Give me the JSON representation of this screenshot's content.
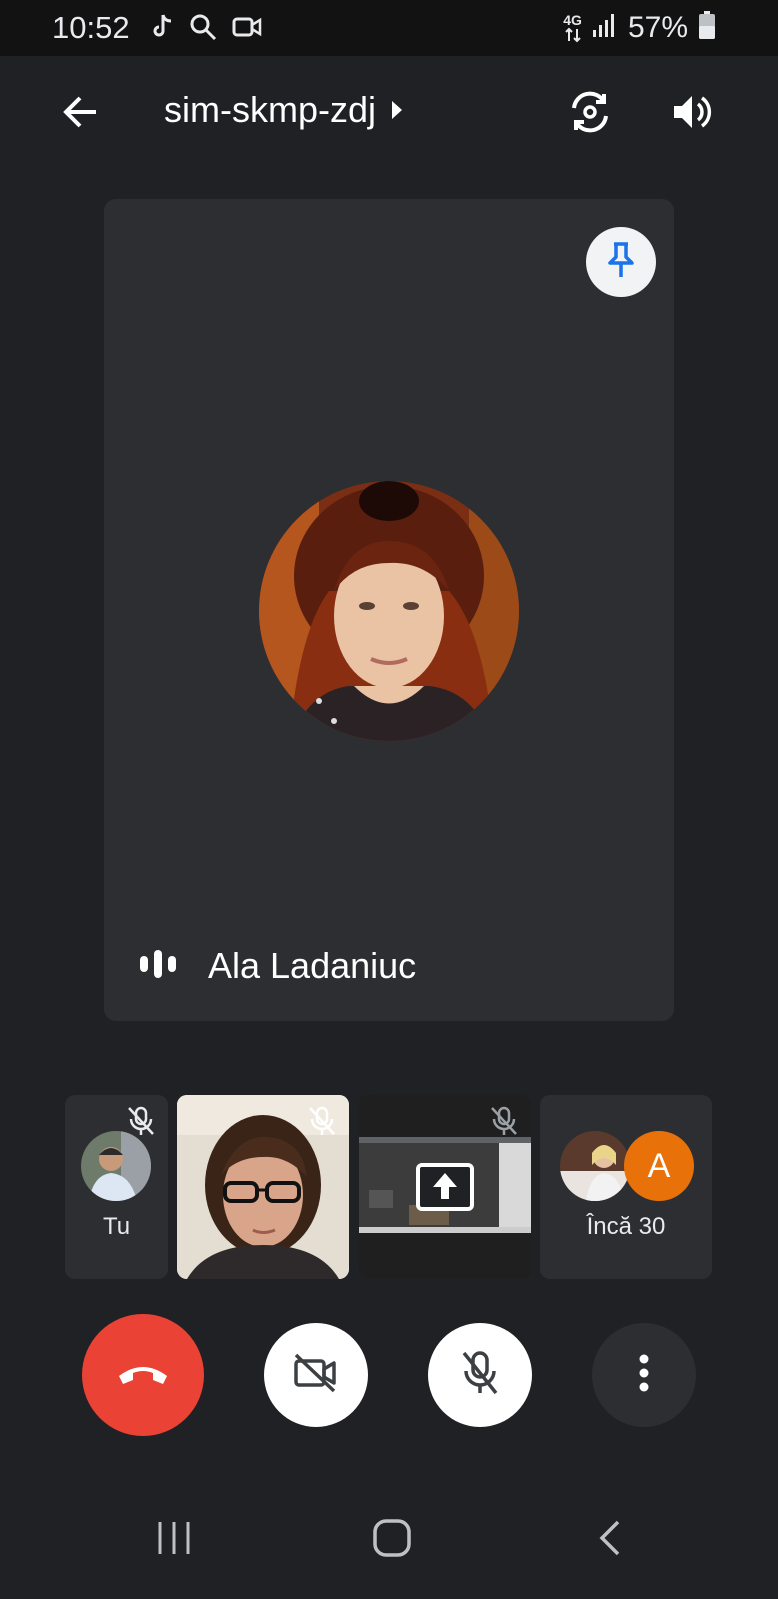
{
  "status_bar": {
    "time": "10:52",
    "battery_percent": "57%",
    "network_label": "4G",
    "icons": [
      "tiktok-icon",
      "search-icon",
      "video-icon",
      "network-4g-icon",
      "signal-icon",
      "battery-icon"
    ]
  },
  "header": {
    "meeting_code": "sim-skmp-zdj",
    "icons": [
      "back-arrow-icon",
      "chevron-right-icon",
      "switch-camera-icon",
      "speaker-volume-icon"
    ]
  },
  "main_tile": {
    "participant_name": "Ala Ladaniuc",
    "icons": [
      "pin-icon",
      "audio-level-icon"
    ]
  },
  "filmstrip": {
    "self_label": "Tu",
    "more_label": "Încă 30",
    "more_avatar_letter": "A",
    "icons": [
      "mic-off-icon",
      "present-screen-icon"
    ]
  },
  "controls": {
    "icons": [
      "end-call-icon",
      "camera-off-icon",
      "mic-off-icon",
      "more-options-icon"
    ]
  },
  "colors": {
    "background": "#202124",
    "tile": "#2d2e31",
    "end_call": "#ea4335",
    "pin_icon": "#1a73e8",
    "letter_avatar": "#e8710a"
  }
}
